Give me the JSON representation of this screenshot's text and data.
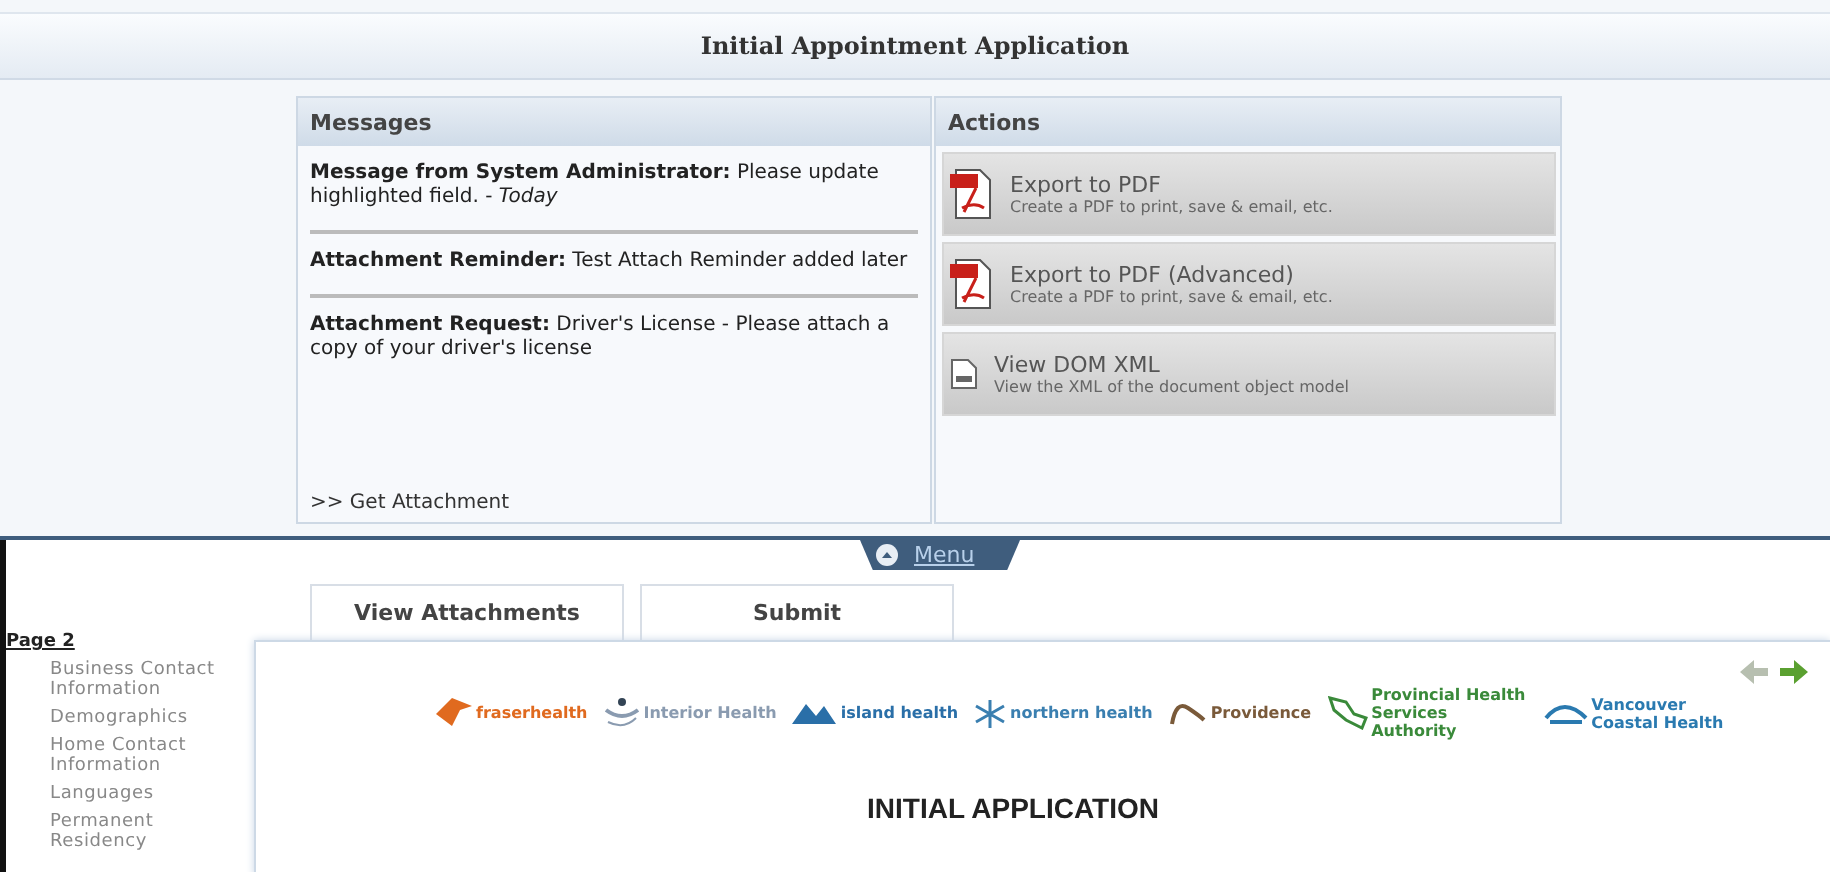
{
  "window": {
    "title": "Initial Appointment Application"
  },
  "messages": {
    "title": "Messages",
    "items": [
      {
        "text": "**Message from System Administrator:** Please update highlighted field. - *Today*"
      },
      {
        "text": "**Attachment Reminder:** Test Attach Reminder added later"
      },
      {
        "text": "**Attachment Request:** Driver's License - Please attach a copy of your driver's license"
      }
    ],
    "link": ">> Get Attachment"
  },
  "actions": {
    "title": "Actions",
    "items": [
      {
        "kind": "pdf",
        "label": "Export to PDF",
        "description": "Create a PDF to print, save & email, etc."
      },
      {
        "kind": "pdf",
        "label": "Export to PDF (Advanced)",
        "description": "Create a PDF to print, save & email, etc."
      },
      {
        "kind": "xml",
        "label": "View DOM XML",
        "description": "View the XML of the document object model"
      }
    ]
  },
  "menu_tab": {
    "label": "Menu"
  },
  "buttons": [
    "View Attachments",
    "Submit"
  ],
  "sidebar": {
    "page": "Page 2",
    "items": [
      "Business Contact Information",
      "Demographics",
      "Home Contact Information",
      "Languages",
      "Permanent Residency"
    ]
  },
  "pager": [
    {
      "kind": "back",
      "disabled": true
    },
    {
      "kind": "forward",
      "disabled": false
    }
  ],
  "logos": [
    {
      "kind": "swoosh",
      "name": "fraserhealth",
      "color": "#e06a1f"
    },
    {
      "kind": "figure",
      "name": "Interior Health",
      "color": "#8a9bb0"
    },
    {
      "kind": "mountains",
      "name": "island health",
      "color": "#2a6fa8"
    },
    {
      "kind": "flake",
      "name": "northern health",
      "color": "#3a7fb0"
    },
    {
      "kind": "script",
      "name": "Providence",
      "color": "#7a5a3a"
    },
    {
      "kind": "map",
      "name": "Provincial Health Services Authority",
      "color": "#3a8a3a"
    },
    {
      "kind": "arc",
      "name": "Vancouver Coastal Health",
      "color": "#2a7ab0"
    }
  ],
  "form": {
    "heading": "INITIAL APPLICATION"
  }
}
